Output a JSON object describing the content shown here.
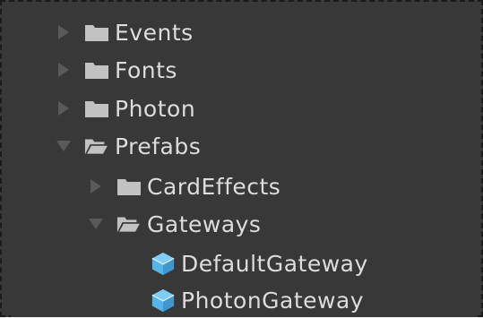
{
  "tree": {
    "items": [
      {
        "label": "Events",
        "icon": "folder-icon",
        "expanded": false,
        "level": 0
      },
      {
        "label": "Fonts",
        "icon": "folder-icon",
        "expanded": false,
        "level": 0
      },
      {
        "label": "Photon",
        "icon": "folder-icon",
        "expanded": false,
        "level": 0
      },
      {
        "label": "Prefabs",
        "icon": "folder-open-icon",
        "expanded": true,
        "level": 0
      },
      {
        "label": "CardEffects",
        "icon": "folder-icon",
        "expanded": false,
        "level": 1
      },
      {
        "label": "Gateways",
        "icon": "folder-open-icon",
        "expanded": true,
        "level": 1
      },
      {
        "label": "DefaultGateway",
        "icon": "prefab-cube-icon",
        "level": 2
      },
      {
        "label": "PhotonGateway",
        "icon": "prefab-cube-icon",
        "level": 2
      }
    ]
  },
  "colors": {
    "background": "#383838",
    "text": "#dcdcdc",
    "arrow": "#5a5a5a",
    "folder": "#c2c2c2",
    "prefab": "#58b4e8"
  }
}
